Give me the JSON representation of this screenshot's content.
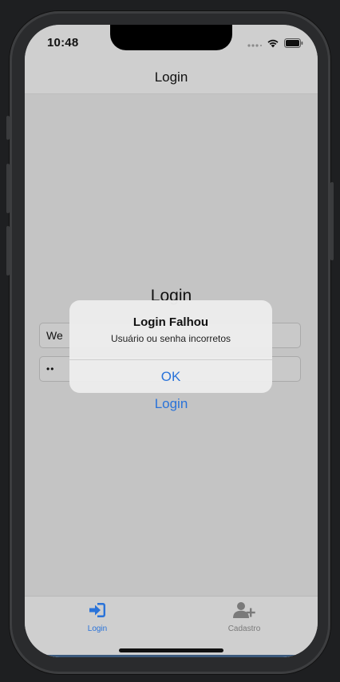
{
  "status_bar": {
    "time": "10:48",
    "icons": [
      "signal-dots-icon",
      "wifi-icon",
      "battery-icon"
    ]
  },
  "nav": {
    "title": "Login"
  },
  "form": {
    "title": "Login",
    "username_value": "We",
    "password_value": "••",
    "submit_label": "Login"
  },
  "alert": {
    "title": "Login Falhou",
    "message": "Usuário ou senha incorretos",
    "ok_label": "OK"
  },
  "tab_bar": {
    "tabs": [
      {
        "label": "Login",
        "icon": "login-arrow-icon",
        "selected": true
      },
      {
        "label": "Cadastro",
        "icon": "add-user-icon",
        "selected": false
      }
    ]
  },
  "colors": {
    "accent": "#2a73d9",
    "inactive": "#7a7a7a",
    "screen_bg": "#c4c4c4"
  }
}
